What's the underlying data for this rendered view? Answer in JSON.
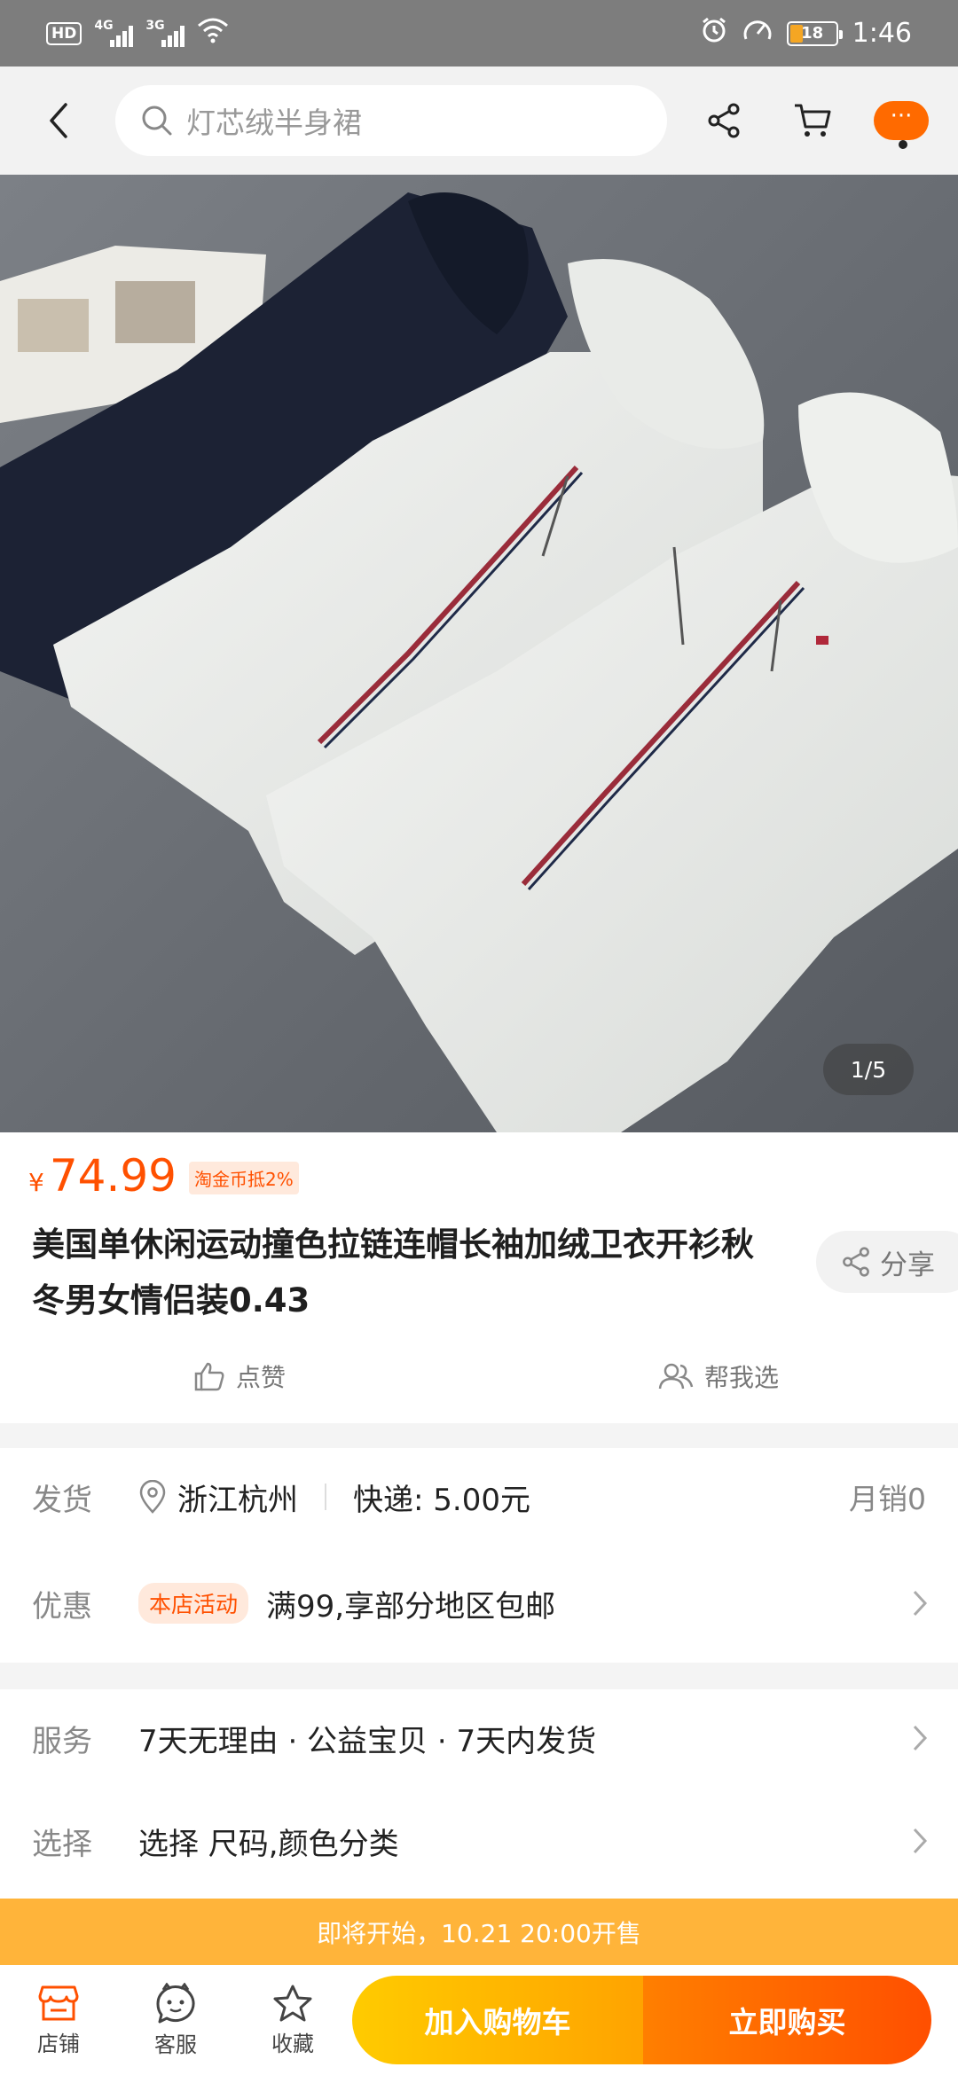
{
  "status_bar": {
    "hd_label": "HD",
    "sim1_label": "4G",
    "sim2_label": "3G",
    "battery": "18",
    "time": "1:46"
  },
  "top_nav": {
    "search_placeholder": "灯芯绒半身裙",
    "more_label": "···"
  },
  "gallery": {
    "indicator": "1/5"
  },
  "product": {
    "currency": "¥",
    "price": "74.99",
    "coin_badge": "淘金币抵2%",
    "title": "美国单休闲运动撞色拉链连帽长袖加绒卫衣开衫秋冬男女情侣装0.43",
    "share_label": "分享",
    "like_label": "点赞",
    "help_choose_label": "帮我选"
  },
  "delivery": {
    "ship_label": "发货",
    "location": "浙江杭州",
    "shipping_fee": "快递: 5.00元",
    "monthly_sales": "月销0",
    "promo_label": "优惠",
    "promo_tag": "本店活动",
    "promo_text": "满99,享部分地区包邮"
  },
  "service": {
    "service_label": "服务",
    "service_text": "7天无理由 · 公益宝贝 · 7天内发货",
    "select_label": "选择",
    "select_text": "选择 尺码,颜色分类"
  },
  "presale_banner": "即将开始，10.21 20:00开售",
  "bottom_bar": {
    "shop": "店铺",
    "service": "客服",
    "favorite": "收藏",
    "add_to_cart": "加入购物车",
    "buy_now": "立即购买"
  },
  "colors": {
    "accent": "#ff5000",
    "cart_button": "#ffa300",
    "buy_button": "#ff5000",
    "presale_bg": "#ffb43a"
  }
}
